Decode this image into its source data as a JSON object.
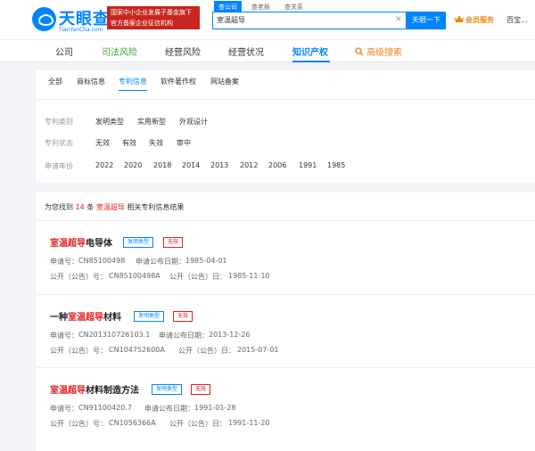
{
  "brand": {
    "name": "天眼查",
    "sub": "TianYanCha.com",
    "banner": "国家中小企业发展子基金旗下 官方备案企业征信机构"
  },
  "search": {
    "tabs": [
      "查公司",
      "查老板",
      "查关系"
    ],
    "query": "室温超导",
    "button": "天眼一下"
  },
  "user": {
    "vip": "会员服务",
    "name": "百宝..."
  },
  "nav": [
    "公司",
    "司法风险",
    "经营风险",
    "经营状况",
    "知识产权",
    "高级搜索"
  ],
  "subtabs": [
    "全部",
    "商标信息",
    "专利信息",
    "软件著作权",
    "网站备案"
  ],
  "filters": [
    {
      "label": "专利类别",
      "options": [
        "发明类型",
        "实用新型",
        "外观设计"
      ]
    },
    {
      "label": "专利状态",
      "options": [
        "无效",
        "有效",
        "失效",
        "审中"
      ]
    },
    {
      "label": "申请年份",
      "options": [
        "2022",
        "2020",
        "2018",
        "2014",
        "2013",
        "2012",
        "2006",
        "1991",
        "1985"
      ]
    }
  ],
  "summary": {
    "prefix": "为您找到",
    "count": "14",
    "mid": "条",
    "keyword": "室温超导",
    "suffix": "相关专利信息结果"
  },
  "results": [
    {
      "title_hl": "室温超导",
      "title_pre": "",
      "title_post": "电导体",
      "type": "发明类型",
      "status": "无效",
      "app_no_label": "申请号：",
      "app_no": "CN85100498",
      "pub_date_label": "申请公布日期：",
      "pub_date": "1985-04-01",
      "pub_no_label": "公开（公告）号：",
      "pub_no": "CN85100498A",
      "pub_day_label": "公开（公告）日：",
      "pub_day": "1985-11-10"
    },
    {
      "title_hl": "室温超导",
      "title_pre": "一种",
      "title_post": "材料",
      "type": "发明类型",
      "status": "无效",
      "app_no_label": "申请号：",
      "app_no": "CN201310726103.1",
      "pub_date_label": "申请公布日期：",
      "pub_date": "2013-12-26",
      "pub_no_label": "公开（公告）号：",
      "pub_no": "CN104752600A",
      "pub_day_label": "公开（公告）日：",
      "pub_day": "2015-07-01"
    },
    {
      "title_hl": "室温超导",
      "title_pre": "",
      "title_post": "材料制造方法",
      "type": "发明类型",
      "status": "无效",
      "app_no_label": "申请号：",
      "app_no": "CN91100420.7",
      "pub_date_label": "申请公布日期：",
      "pub_date": "1991-01-28",
      "pub_no_label": "公开（公告）号：",
      "pub_no": "CN1056366A",
      "pub_day_label": "公开（公告）日：",
      "pub_day": "1991-11-20"
    }
  ],
  "colors": {
    "accent": "#0084ff",
    "highlight": "#e02020",
    "vip": "#e88a13"
  },
  "icons": {
    "logo": "eye-logo-icon",
    "clear": "clear-icon",
    "vip": "crown-icon",
    "advanced": "magnifier-icon"
  }
}
